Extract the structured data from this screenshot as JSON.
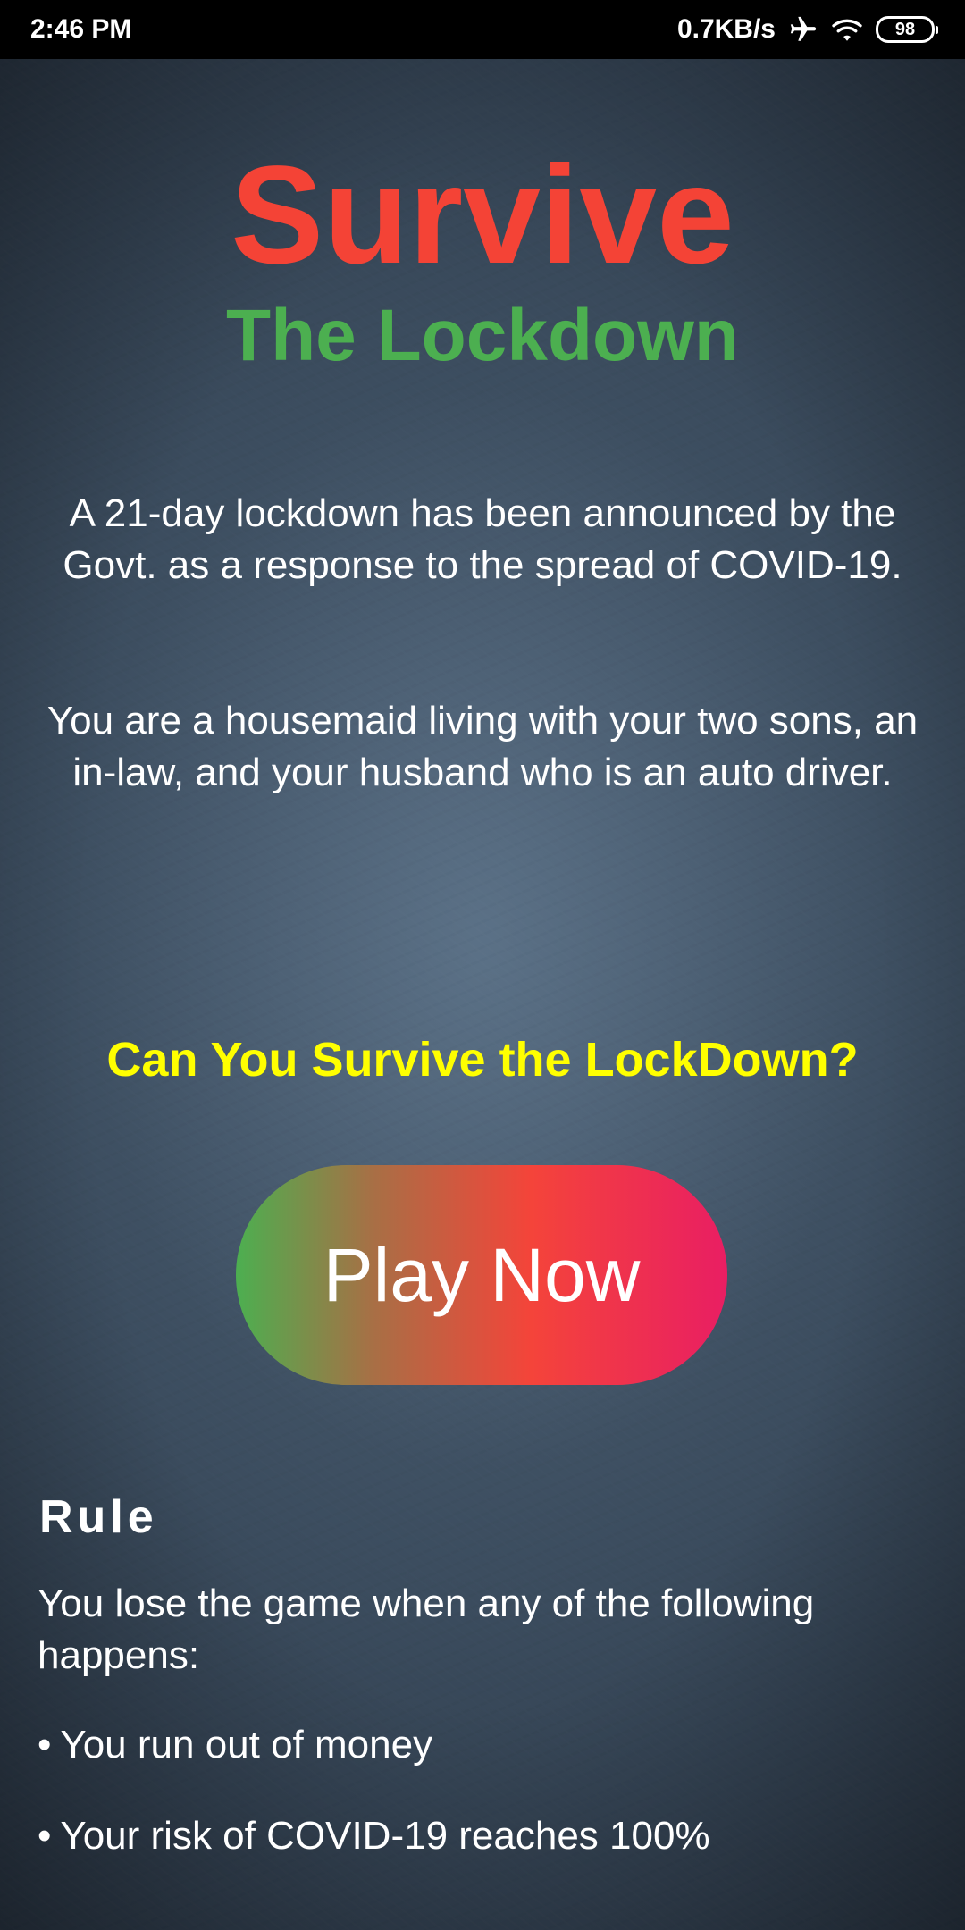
{
  "status_bar": {
    "time": "2:46 PM",
    "network_speed": "0.7KB/s",
    "battery_level": "98",
    "icons": [
      "airplane-icon",
      "wifi-icon",
      "battery-icon"
    ]
  },
  "hero": {
    "title": "Survive",
    "subtitle": "The Lockdown"
  },
  "intro": {
    "announcement": "A 21-day lockdown has been announced by the Govt. as a response to the spread of COVID-19.",
    "story": "You are a housemaid living with your two sons, an in-law, and your husband who is an auto driver."
  },
  "question": "Can You Survive the LockDown?",
  "play_button_label": "Play Now",
  "rules": {
    "heading": "Rule",
    "intro": "You lose the game when any of the following happens:",
    "items": [
      "You run out of money",
      "Your risk of COVID-19 reaches 100%"
    ],
    "bullet": "•"
  },
  "colors": {
    "title": "#f44336",
    "subtitle": "#4caf50",
    "question": "#ffff00",
    "button_gradient": [
      "#4caf50",
      "#f4443a",
      "#e91e63"
    ],
    "background": "#3f5264"
  }
}
